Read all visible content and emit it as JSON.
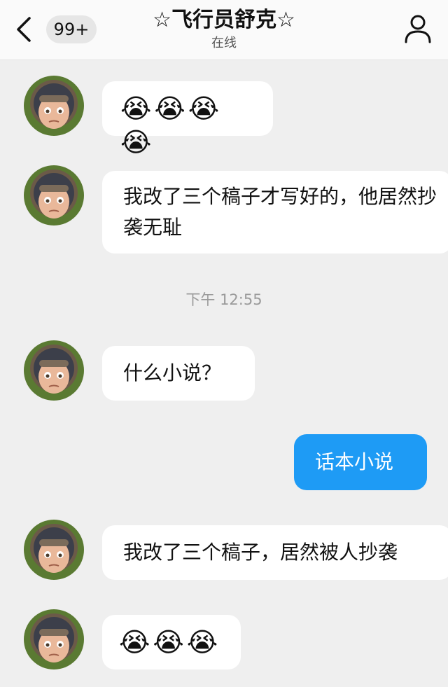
{
  "header": {
    "unread_count": "99+",
    "title": "☆飞行员舒克☆",
    "status": "在线"
  },
  "messages": [
    {
      "type": "incoming",
      "text": "😭😭😭😭"
    },
    {
      "type": "incoming",
      "text": "我改了三个稿子才写好的，他居然抄袭无耻"
    },
    {
      "type": "time",
      "text": "下午 12:55"
    },
    {
      "type": "incoming",
      "text": "什么小说？"
    },
    {
      "type": "outgoing",
      "text": "话本小说"
    },
    {
      "type": "incoming",
      "text": "我改了三个稿子，居然被人抄袭"
    },
    {
      "type": "incoming",
      "text": "😭😭😭"
    }
  ],
  "icons": {
    "back": "chevron-left-icon",
    "profile": "person-icon",
    "avatar": "cartoon-pilot-avatar"
  },
  "colors": {
    "outgoing_bubble": "#1e9bf5",
    "chat_background": "#efefef"
  }
}
